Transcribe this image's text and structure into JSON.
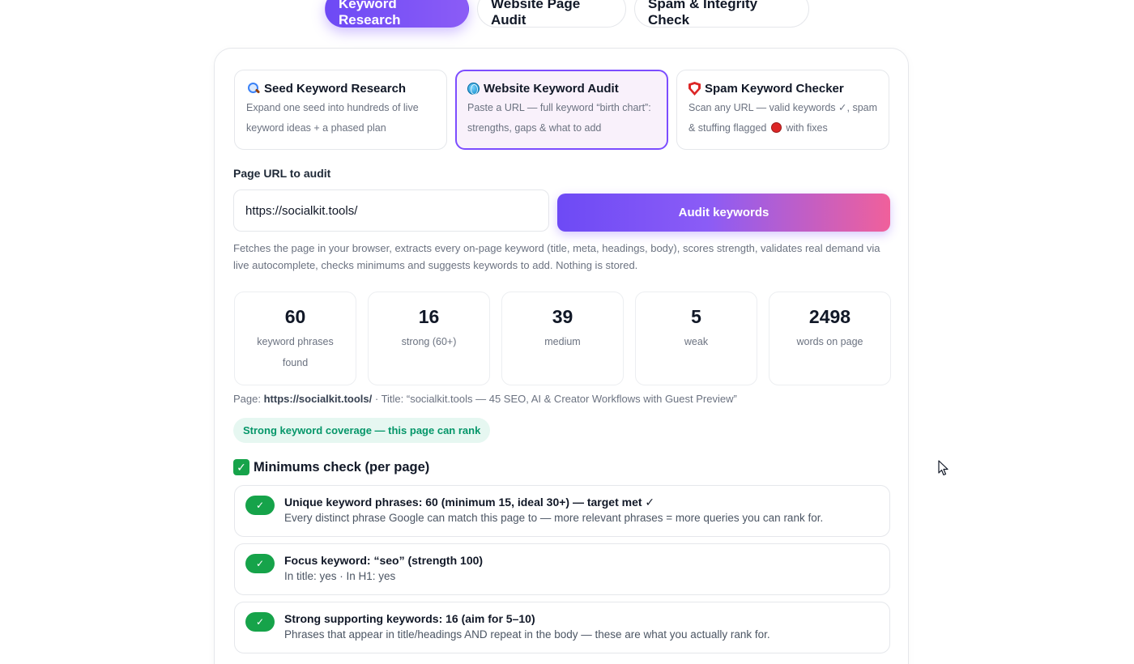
{
  "top_tabs": [
    {
      "label": "Keyword Research",
      "active": true
    },
    {
      "label": "Website Page Audit",
      "active": false
    },
    {
      "label": "Spam & Integrity Check",
      "active": false
    }
  ],
  "modes": [
    {
      "icon": "magnifier-icon",
      "title": "Seed Keyword Research",
      "desc": "Expand one seed into hundreds of live keyword ideas + a phased plan",
      "active": false
    },
    {
      "icon": "globe-icon",
      "title": "Website Keyword Audit",
      "desc": "Paste a URL — full keyword “birth chart”: strengths, gaps & what to add",
      "active": true
    },
    {
      "icon": "shield-icon",
      "title": "Spam Keyword Checker",
      "desc_before": "Scan any URL — valid keywords ✓, spam & stuffing flagged",
      "desc_after": "with fixes",
      "active": false
    }
  ],
  "form": {
    "label": "Page URL to audit",
    "url_value": "https://socialkit.tools/",
    "button_label": "Audit keywords",
    "help": "Fetches the page in your browser, extracts every on-page keyword (title, meta, headings, body), scores strength, validates real demand via live autocomplete, checks minimums and suggests keywords to add. Nothing is stored."
  },
  "stats": [
    {
      "value": "60",
      "label": "keyword phrases found"
    },
    {
      "value": "16",
      "label": "strong (60+)"
    },
    {
      "value": "39",
      "label": "medium"
    },
    {
      "value": "5",
      "label": "weak"
    },
    {
      "value": "2498",
      "label": "words on page"
    }
  ],
  "page_info": {
    "prefix": "Page:",
    "url": "https://socialkit.tools/",
    "title_part": "· Title: “socialkit.tools — 45 SEO, AI & Creator Workflows with Guest Preview”"
  },
  "coverage_badge": "Strong keyword coverage — this page can rank",
  "minimums": {
    "heading": "Minimums check (per page)",
    "items": [
      {
        "title": "Unique keyword phrases: 60 (minimum 15, ideal 30+) — target met ✓",
        "desc": "Every distinct phrase Google can match this page to — more relevant phrases = more queries you can rank for."
      },
      {
        "title": "Focus keyword: “seo” (strength 100)",
        "desc": "In title: yes · In H1: yes"
      },
      {
        "title": "Strong supporting keywords: 16 (aim for 5–10)",
        "desc": "Phrases that appear in title/headings AND repeat in the body — these are what you actually rank for."
      }
    ]
  },
  "colors": {
    "accent": "#7c4dff",
    "gradient_end": "#f0609b",
    "success": "#16a34a",
    "coverage_bg": "#e6f7f1",
    "coverage_text": "#059669"
  }
}
